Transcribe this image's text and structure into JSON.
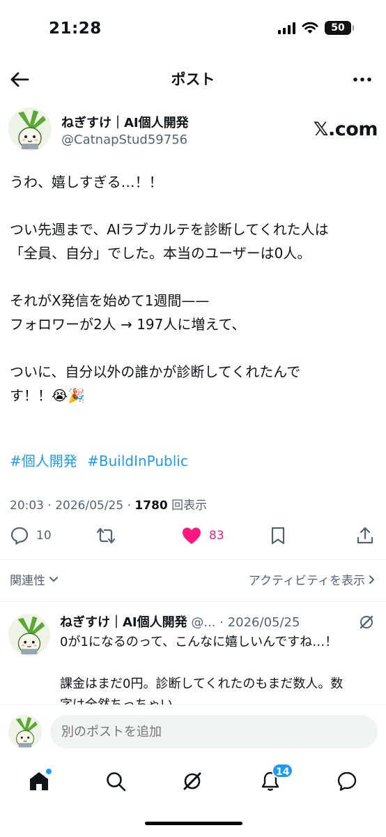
{
  "status_bar": {
    "time": "21:28",
    "battery": "50"
  },
  "header": {
    "title": "ポスト"
  },
  "post": {
    "author_name": "ねぎすけ｜AI個人開発",
    "author_handle": "@CatnapStud59756",
    "source_brand": "𝕏.com",
    "lines": [
      "うわ、嬉しすぎる…！！",
      "",
      "つい先週まで、AIラブカルテを診断してくれた人は",
      "「全員、自分」でした。本当のユーザーは0人。",
      "",
      "それがX発信を始めて1週間——",
      "フォロワーが2人 → 197人に増えて、",
      "",
      "ついに、自分以外の誰かが診断してくれたんで",
      "す！！😭🎉"
    ],
    "hashtags": [
      "#個人開発",
      "#BuildInPublic"
    ],
    "timestamp": "20:03 · 2026/05/25 · ",
    "views_count": "1780",
    "views_label": " 回表示",
    "replies_count": "10",
    "likes_count": "83"
  },
  "filter": {
    "sort_label": "関連性",
    "activity_label": "アクティビティを表示"
  },
  "reply": {
    "author_name": "ねぎすけ｜AI個人開発",
    "handle_date": " @... · 2026/05/25",
    "lines": [
      "0が1になるのって、こんなに嬉しいんですね…！",
      "",
      "課金はまだ0円。診断してくれたのもまだ数人。数",
      "字は全然ちっちゃい。"
    ]
  },
  "compose": {
    "placeholder": "別のポストを追加"
  },
  "tabbar": {
    "notifications_badge": "14"
  },
  "colors": {
    "accent": "#1d9bf0",
    "like": "#f91880",
    "text": "#0f1419",
    "secondary": "#536471"
  }
}
